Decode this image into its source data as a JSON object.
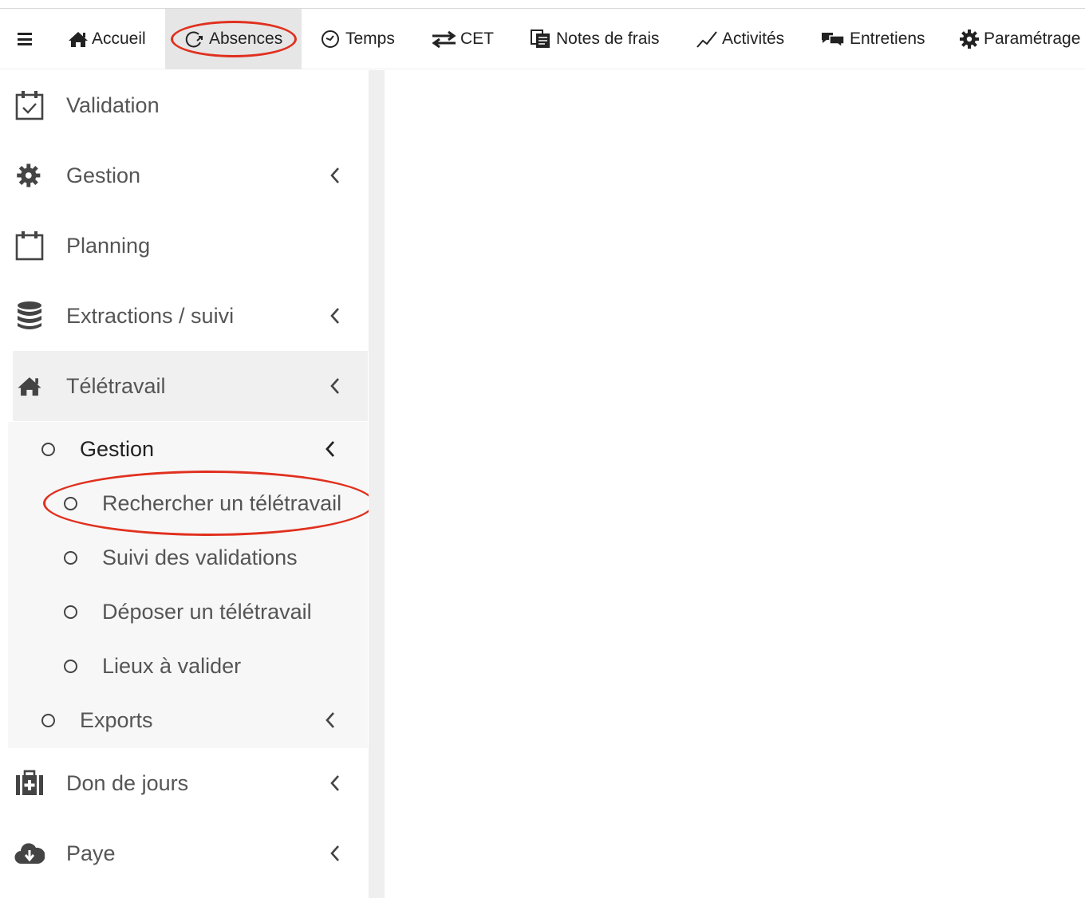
{
  "topnav": {
    "menu_icon": "hamburger-icon",
    "items": [
      {
        "label": "Accueil",
        "icon": "home-icon"
      },
      {
        "label": "Absences",
        "icon": "clock-arrow-icon",
        "active": true
      },
      {
        "label": "Temps",
        "icon": "clock-icon"
      },
      {
        "label": "CET",
        "icon": "exchange-arrows-icon"
      },
      {
        "label": "Notes de frais",
        "icon": "document-icon"
      },
      {
        "label": "Activités",
        "icon": "line-chart-icon"
      },
      {
        "label": "Entretiens",
        "icon": "conversation-icon"
      },
      {
        "label": "Paramétrage",
        "icon": "gear-icon"
      }
    ]
  },
  "sidebar": {
    "items": [
      {
        "label": "Validation",
        "icon": "calendar-check-icon",
        "has_children": false
      },
      {
        "label": "Gestion",
        "icon": "gear-icon",
        "has_children": true
      },
      {
        "label": "Planning",
        "icon": "calendar-icon",
        "has_children": false
      },
      {
        "label": "Extractions / suivi",
        "icon": "database-icon",
        "has_children": true
      },
      {
        "label": "Télétravail",
        "icon": "home-icon",
        "has_children": true,
        "active": true
      },
      {
        "label": "Don de jours",
        "icon": "medkit-icon",
        "has_children": true
      },
      {
        "label": "Paye",
        "icon": "cloud-download-icon",
        "has_children": true
      }
    ],
    "teletravail_submenu": {
      "gestion": {
        "label": "Gestion",
        "children": [
          {
            "label": "Rechercher un télétravail",
            "highlighted": true
          },
          {
            "label": "Suivi des validations"
          },
          {
            "label": "Déposer un télétravail"
          },
          {
            "label": "Lieux à valider"
          }
        ]
      },
      "exports": {
        "label": "Exports"
      }
    }
  },
  "colors": {
    "annotation": "#e0301e",
    "active_tab_bg": "#e6e6e6",
    "active_sidebar_bg": "#f0f0f0",
    "submenu_bg": "#f7f7f7"
  }
}
